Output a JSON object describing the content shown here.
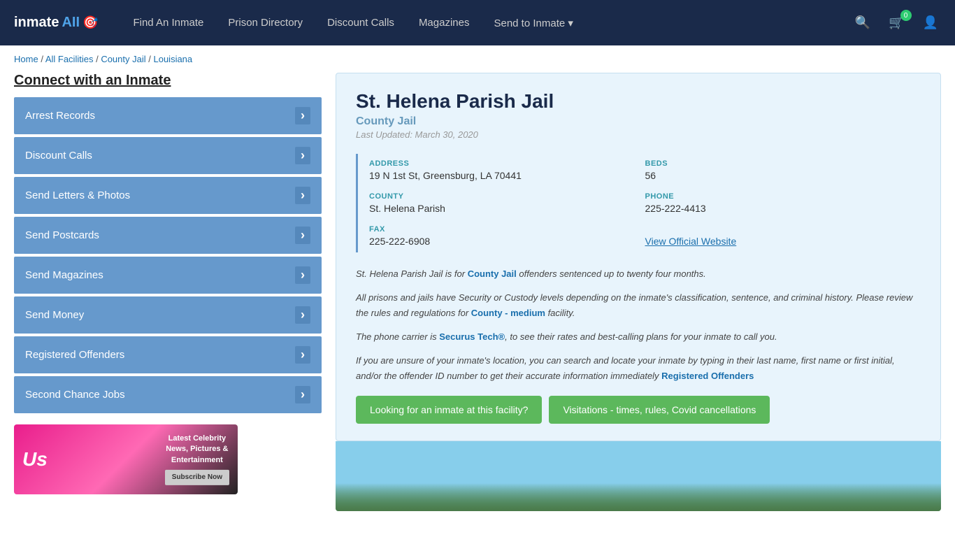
{
  "navbar": {
    "logo_text": "inmate",
    "logo_all": "AII",
    "nav_items": [
      {
        "label": "Find An Inmate",
        "id": "find-inmate"
      },
      {
        "label": "Prison Directory",
        "id": "prison-directory"
      },
      {
        "label": "Discount Calls",
        "id": "discount-calls"
      },
      {
        "label": "Magazines",
        "id": "magazines"
      },
      {
        "label": "Send to Inmate ▾",
        "id": "send-to-inmate"
      }
    ],
    "cart_count": "0",
    "search_placeholder": "Search"
  },
  "breadcrumb": {
    "home": "Home",
    "all_facilities": "All Facilities",
    "county_jail": "County Jail",
    "state": "Louisiana",
    "separator": " / "
  },
  "sidebar": {
    "title": "Connect with an Inmate",
    "items": [
      {
        "label": "Arrest Records",
        "id": "arrest-records"
      },
      {
        "label": "Discount Calls",
        "id": "discount-calls"
      },
      {
        "label": "Send Letters & Photos",
        "id": "send-letters"
      },
      {
        "label": "Send Postcards",
        "id": "send-postcards"
      },
      {
        "label": "Send Magazines",
        "id": "send-magazines"
      },
      {
        "label": "Send Money",
        "id": "send-money"
      },
      {
        "label": "Registered Offenders",
        "id": "registered-offenders"
      },
      {
        "label": "Second Chance Jobs",
        "id": "second-chance-jobs"
      }
    ],
    "ad": {
      "logo": "Us",
      "line1": "Latest Celebrity",
      "line2": "News, Pictures &",
      "line3": "Entertainment",
      "subscribe_label": "Subscribe Now"
    }
  },
  "facility": {
    "name": "St. Helena Parish Jail",
    "type": "County Jail",
    "last_updated": "Last Updated: March 30, 2020",
    "address_label": "ADDRESS",
    "address_value": "19 N 1st St, Greensburg, LA 70441",
    "beds_label": "BEDS",
    "beds_value": "56",
    "county_label": "COUNTY",
    "county_value": "St. Helena Parish",
    "phone_label": "PHONE",
    "phone_value": "225-222-4413",
    "fax_label": "FAX",
    "fax_value": "225-222-6908",
    "website_label": "View Official Website",
    "desc1": "St. Helena Parish Jail is for County Jail offenders sentenced up to twenty four months.",
    "desc2": "All prisons and jails have Security or Custody levels depending on the inmate's classification, sentence, and criminal history. Please review the rules and regulations for County - medium facility.",
    "desc3": "The phone carrier is Securus Tech®, to see their rates and best-calling plans for your inmate to call you.",
    "desc4": "If you are unsure of your inmate's location, you can search and locate your inmate by typing in their last name, first name or first initial, and/or the offender ID number to get their accurate information immediately Registered Offenders",
    "btn_looking": "Looking for an inmate at this facility?",
    "btn_visitations": "Visitations - times, rules, Covid cancellations"
  }
}
